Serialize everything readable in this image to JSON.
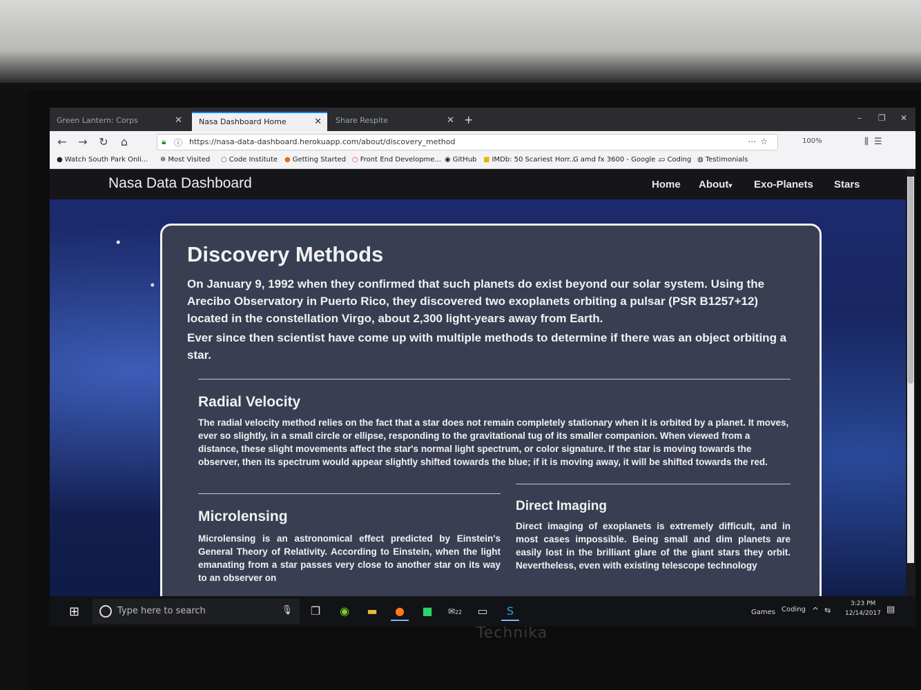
{
  "browser": {
    "tabs": [
      {
        "label": "Green Lantern: Corps",
        "active": false
      },
      {
        "label": "Nasa Dashboard Home",
        "active": true
      },
      {
        "label": "Share Respite",
        "active": false
      }
    ],
    "url": "https://nasa-data-dashboard.herokuapp.com/about/discovery_method",
    "zoom": "100%",
    "bookmarks": [
      "Watch South Park Onli...",
      "Most Visited",
      "Code Institute",
      "Getting Started",
      "Front End Developme...",
      "GitHub",
      "IMDb: 50 Scariest Horr...",
      "amd fx 3600 - Google ...",
      "Coding",
      "Testimonials"
    ]
  },
  "site": {
    "brand": "Nasa Data Dashboard",
    "nav": [
      "Home",
      "About",
      "Exo-Planets",
      "Stars"
    ]
  },
  "content": {
    "title": "Discovery Methods",
    "intro1": "On January 9, 1992 when they confirmed that such planets do exist beyond our solar system. Using the Arecibo Observatory in Puerto Rico, they discovered two exoplanets orbiting a pulsar (PSR B1257+12) located in the constellation Virgo, about 2,300 light-years away from Earth.",
    "intro2": "Ever since then scientist have come up with multiple methods to determine if there was an object orbiting a star.",
    "radial": {
      "title": "Radial Velocity",
      "text": "The radial velocity method relies on the fact that a star does not remain completely stationary when it is orbited by a planet. It moves, ever so slightly, in a small circle or ellipse, responding to the gravitational tug of its smaller companion. When viewed from a distance, these slight movements affect the star's normal light spectrum, or color signature. If the star is moving towards the observer, then its spectrum would appear slightly shifted towards the blue; if it is moving away, it will be shifted towards the red."
    },
    "microlensing": {
      "title": "Microlensing",
      "text": "Microlensing is an astronomical effect predicted by Einstein's General Theory of Relativity. According to Einstein, when the light emanating from a star passes very close to another star on its way to an observer on"
    },
    "imaging": {
      "title": "Direct Imaging",
      "text": "Direct imaging of exoplanets is extremely difficult, and in most cases impossible. Being small and dim planets are easily lost in the brilliant glare of the giant stars they orbit. Nevertheless, even with existing telescope technology"
    }
  },
  "taskbar": {
    "search_placeholder": "Type here to search",
    "tray_items": [
      "Games",
      "Coding"
    ],
    "time": "3:23 PM",
    "date": "12/14/2017",
    "badge": "22"
  },
  "monitor": {
    "brand": "Technika"
  }
}
